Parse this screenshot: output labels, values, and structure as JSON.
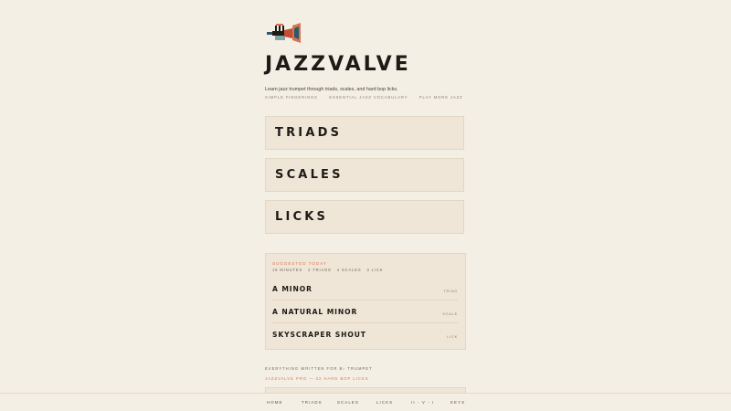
{
  "app": {
    "title": "JAZZVALVE",
    "tagline": "Learn jazz trumpet through triads, scales, and hard bop licks.",
    "subnav": [
      "SIMPLE FINGERINGS",
      "ESSENTIAL JAZZ VOCABULARY",
      "PLAY MORE JAZZ"
    ],
    "subnav_separator": "·",
    "logo_icon": "trumpet-icon"
  },
  "categories": [
    {
      "label": "TRIADS"
    },
    {
      "label": "SCALES"
    },
    {
      "label": "LICKS"
    }
  ],
  "suggested": {
    "heading": "SUGGESTED TODAY",
    "meta": [
      "15 MINUTES",
      "2 TRIADS",
      "4 SCALES",
      "3 LICK"
    ],
    "items": [
      {
        "name": "A MINOR",
        "kind": "TRIAD"
      },
      {
        "name": "A NATURAL MINOR",
        "kind": "SCALE"
      },
      {
        "name": "SKYSCRAPER SHOUT",
        "kind": "LICK"
      }
    ]
  },
  "footer": {
    "note": "EVERYTHING WRITTEN FOR B♭ TRUMPET",
    "pro_link": "JAZZVALVE PRO — 32 HARD BOP LICKS"
  },
  "bottom_nav": [
    {
      "label": "HOME"
    },
    {
      "label": "TRIADS"
    },
    {
      "label": "SCALES"
    },
    {
      "label": "LICKS"
    },
    {
      "label": "II - V - I"
    },
    {
      "label": "KEYS"
    }
  ],
  "colors": {
    "background": "#f4efe4",
    "card": "#efe6d7",
    "accent": "#d9734f",
    "text": "#1e1a16"
  }
}
